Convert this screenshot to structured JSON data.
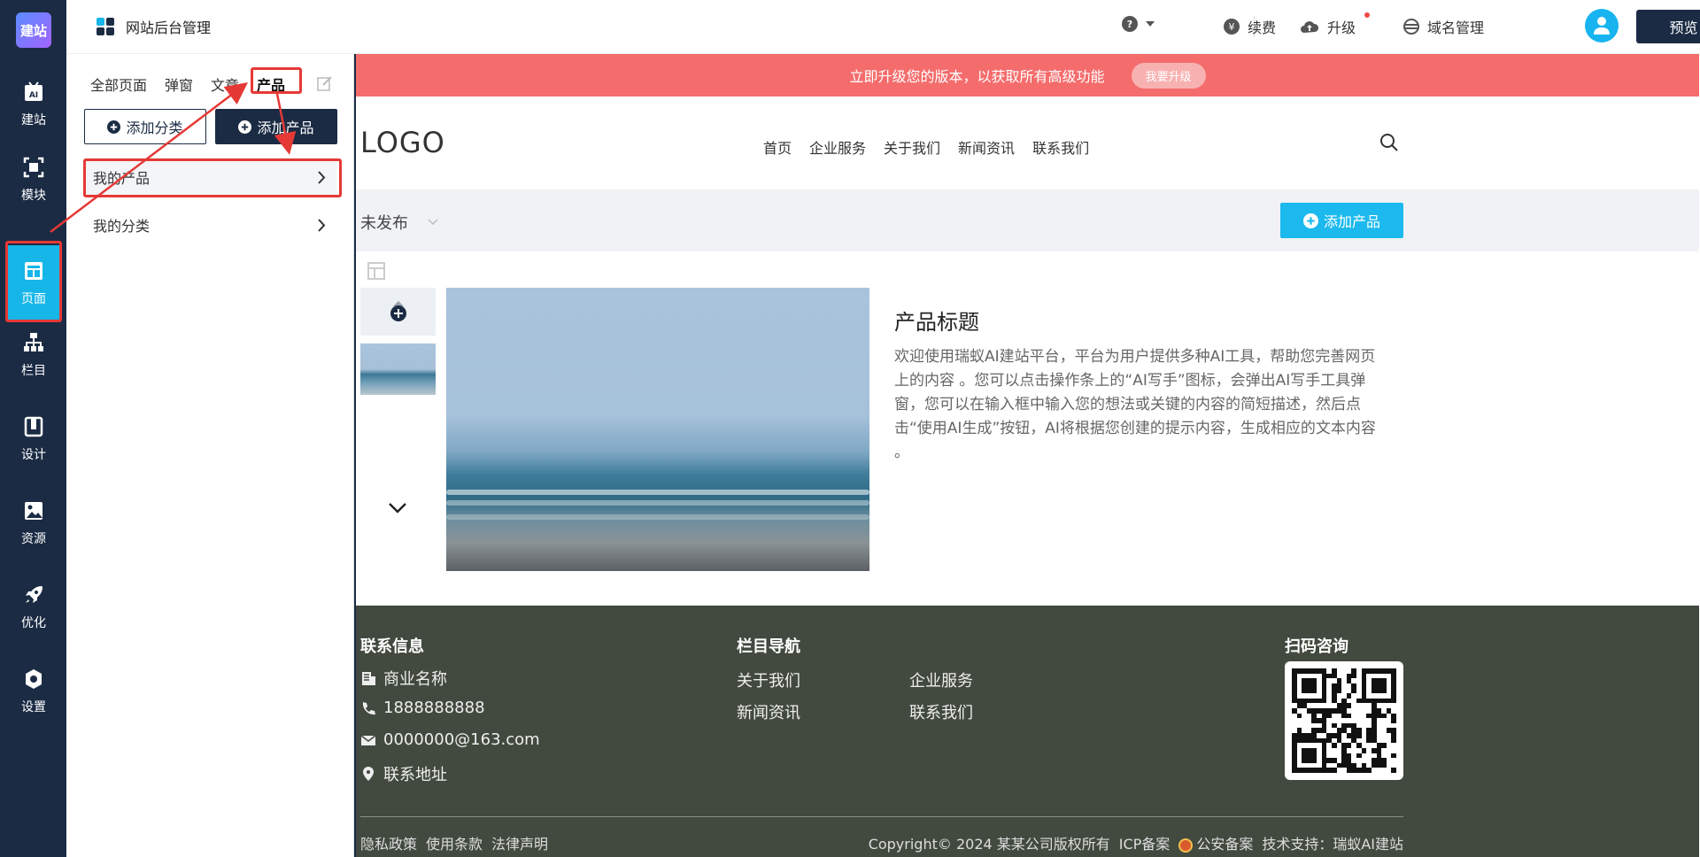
{
  "rail": {
    "logo": "建站",
    "items": [
      {
        "label": "建站",
        "icon": "ai-icon"
      },
      {
        "label": "模块",
        "icon": "module-icon"
      },
      {
        "label": "页面",
        "icon": "page-icon"
      },
      {
        "label": "栏目",
        "icon": "sitemap-icon"
      },
      {
        "label": "设计",
        "icon": "design-icon"
      },
      {
        "label": "资源",
        "icon": "image-icon"
      },
      {
        "label": "优化",
        "icon": "rocket-icon"
      },
      {
        "label": "设置",
        "icon": "gear-icon"
      }
    ]
  },
  "topbar": {
    "title": "网站后台管理",
    "renew": "续费",
    "upgrade": "升级",
    "domain": "域名管理",
    "preview": "预览"
  },
  "panel": {
    "tabs": [
      "全部页面",
      "弹窗",
      "文章",
      "产品"
    ],
    "add_category": "添加分类",
    "add_product": "添加产品",
    "list": [
      {
        "label": "我的产品"
      },
      {
        "label": "我的分类"
      }
    ]
  },
  "site": {
    "upgrade_banner": "立即升级您的版本，以获取所有高级功能",
    "upgrade_pill": "我要升级",
    "logo": "LOGO",
    "nav": [
      "首页",
      "企业服务",
      "关于我们",
      "新闻资讯",
      "联系我们"
    ],
    "filter_select": "未发布",
    "add_product": "添加产品",
    "product_title": "产品标题",
    "product_desc": "欢迎使用瑞蚁AI建站平台，平台为用户提供多种AI工具，帮助您完善网页上的内容 。您可以点击操作条上的“AI写手”图标，会弹出AI写手工具弹窗，您可以在输入框中输入您的想法或关键的内容的简短描述，然后点击“使用AI生成”按钮，AI将根据您创建的提示内容，生成相应的文本内容 。"
  },
  "footer": {
    "contact_heading": "联系信息",
    "company": "商业名称",
    "phone": "1888888888",
    "email": "0000000@163.com",
    "address": "联系地址",
    "nav_heading": "栏目导航",
    "nav_links": [
      "关于我们",
      "企业服务",
      "新闻资讯",
      "联系我们"
    ],
    "qr_heading": "扫码咨询",
    "legal_links": [
      "隐私政策",
      "使用条款",
      "法律声明"
    ],
    "copyright": "Copyright© 2024 某某公司版权所有",
    "icp": "ICP备案",
    "police": "公安备案",
    "support": "技术支持：瑞蚁AI建站"
  },
  "colors": {
    "rail_bg": "#1b2b44",
    "rail_active": "#16b6e8",
    "banner_red": "#f56c6c",
    "accent_cyan": "#1bb9ee",
    "footer_bg": "#424a3f",
    "annotation_red": "#e53935"
  }
}
